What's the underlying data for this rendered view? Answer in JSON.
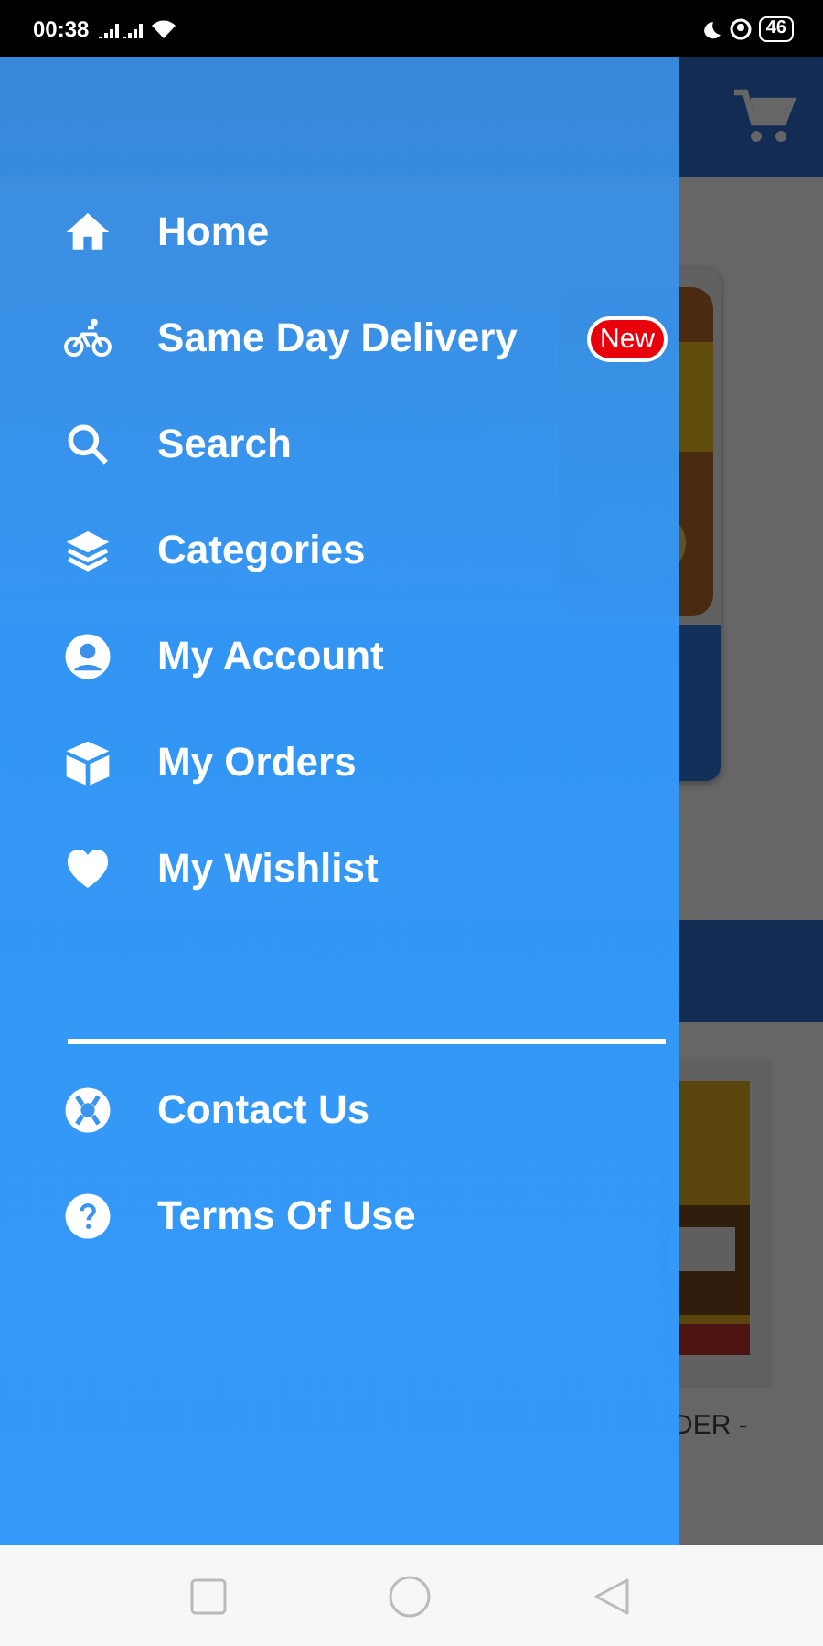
{
  "status_bar": {
    "time": "00:38",
    "battery": "46"
  },
  "home": {
    "product": {
      "name": "DER -"
    }
  },
  "drawer": {
    "items": [
      {
        "label": "Home",
        "kind": "home"
      },
      {
        "label": "Same Day Delivery",
        "kind": "bike",
        "badge": "New"
      },
      {
        "label": "Search",
        "kind": "search"
      },
      {
        "label": "Categories",
        "kind": "layers"
      },
      {
        "label": "My Account",
        "kind": "account"
      },
      {
        "label": "My Orders",
        "kind": "box"
      },
      {
        "label": "My Wishlist",
        "kind": "heart"
      }
    ],
    "footer_items": [
      {
        "label": "Contact Us",
        "kind": "lifebuoy"
      },
      {
        "label": "Terms Of Use",
        "kind": "help"
      }
    ]
  }
}
